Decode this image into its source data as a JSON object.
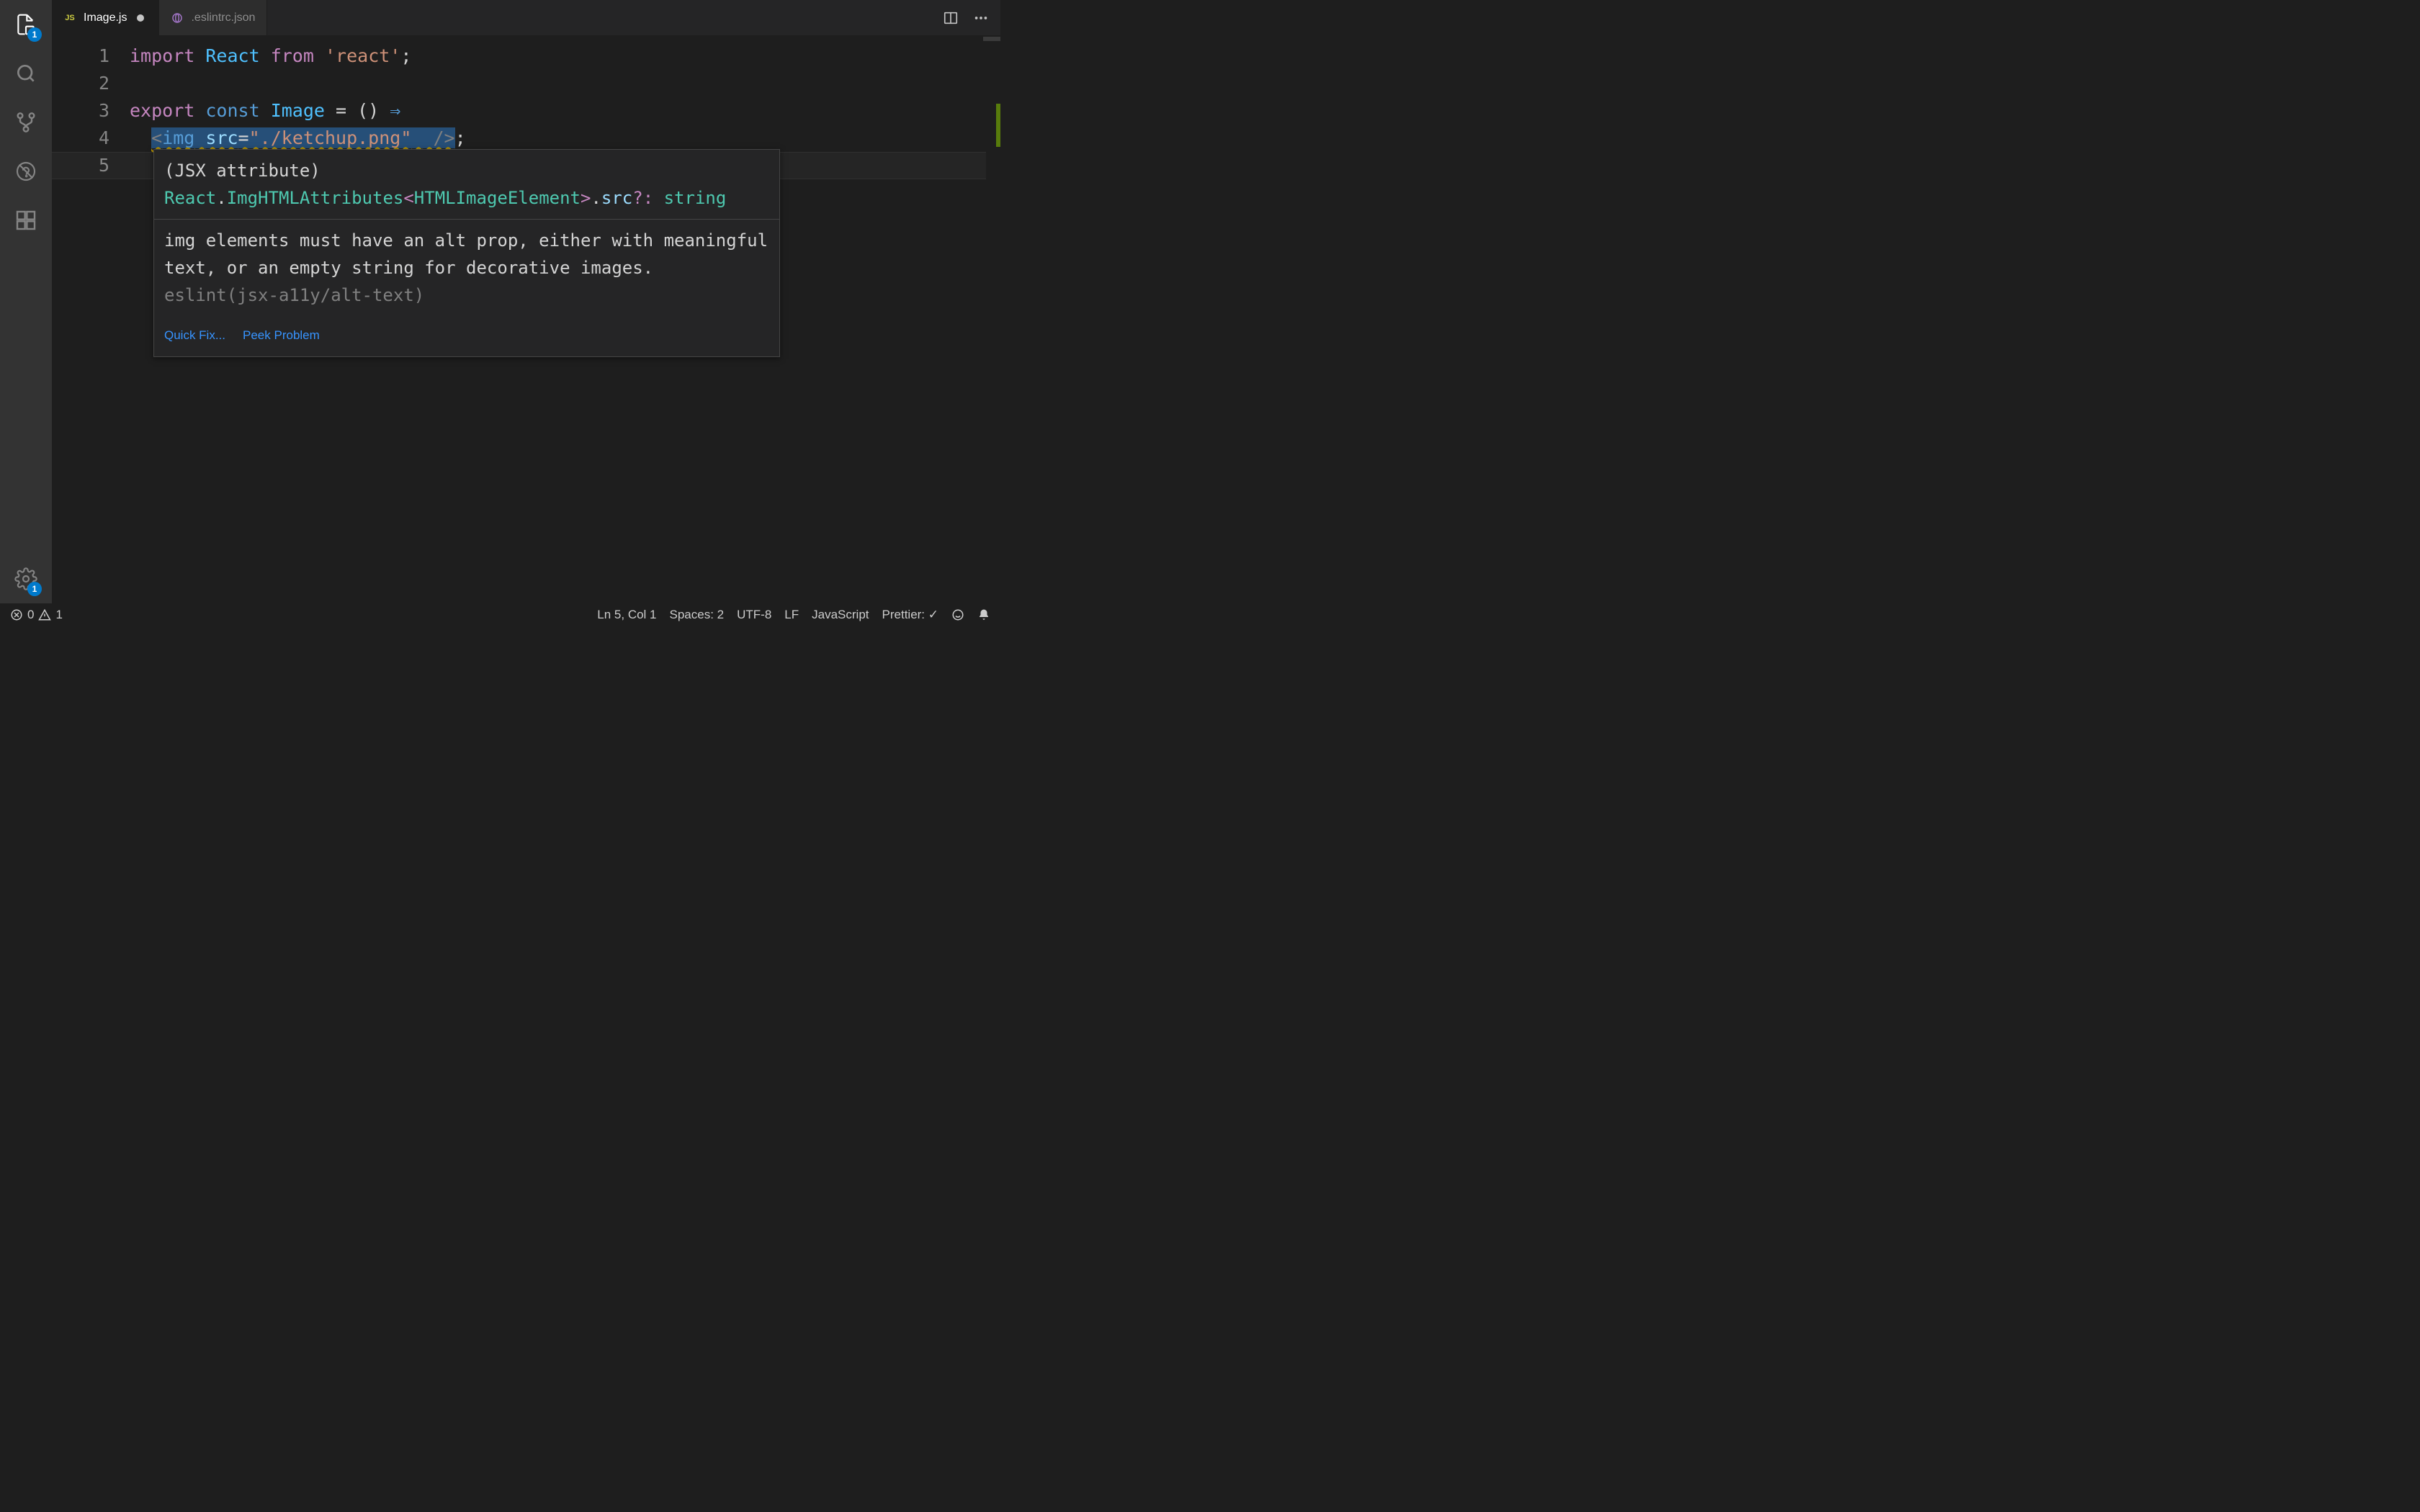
{
  "activity_bar": {
    "explorer_badge": "1",
    "settings_badge": "1"
  },
  "tabs": [
    {
      "icon": "JS",
      "label": "Image.js",
      "active": true,
      "dirty": true
    },
    {
      "icon": "json",
      "label": ".eslintrc.json",
      "active": false,
      "dirty": false
    }
  ],
  "code": {
    "lines": [
      "1",
      "2",
      "3",
      "4",
      "5"
    ],
    "line1": {
      "import": "import",
      "react": "React",
      "from": "from",
      "quote": "'react'",
      "semi": ";"
    },
    "line3": {
      "export": "export",
      "const": "const",
      "name": "Image",
      "eq": " = ",
      "parens": "()",
      "arrow": " ⇒"
    },
    "line4": {
      "indent": "  ",
      "open": "<",
      "tag": "img",
      "sp1": " ",
      "attr": "src",
      "eq": "=",
      "val": "\"./ketchup.png\"",
      "sp2": " ",
      "close": " />",
      "semi": ";"
    }
  },
  "hover": {
    "sig_prefix": "(JSX attribute) ",
    "sig_ns": "React",
    "sig_dot1": ".",
    "sig_type": "ImgHTMLAttributes",
    "sig_lt": "<",
    "sig_gen": "HTMLImageElement",
    "sig_gt": ">",
    "sig_dot2": ".",
    "sig_prop": "src",
    "sig_opt": "?:",
    "sig_sp": " ",
    "sig_ret": "string",
    "lint_msg": "img elements must have an alt prop, either with meaningful text, or an empty string for decorative images. ",
    "lint_rule": "eslint(jsx-a11y/alt-text)",
    "quick_fix": "Quick Fix...",
    "peek": "Peek Problem"
  },
  "status": {
    "errors": "0",
    "warnings": "1",
    "ln_col": "Ln 5, Col 1",
    "spaces": "Spaces: 2",
    "encoding": "UTF-8",
    "eol": "LF",
    "language": "JavaScript",
    "prettier": "Prettier: ✓"
  }
}
